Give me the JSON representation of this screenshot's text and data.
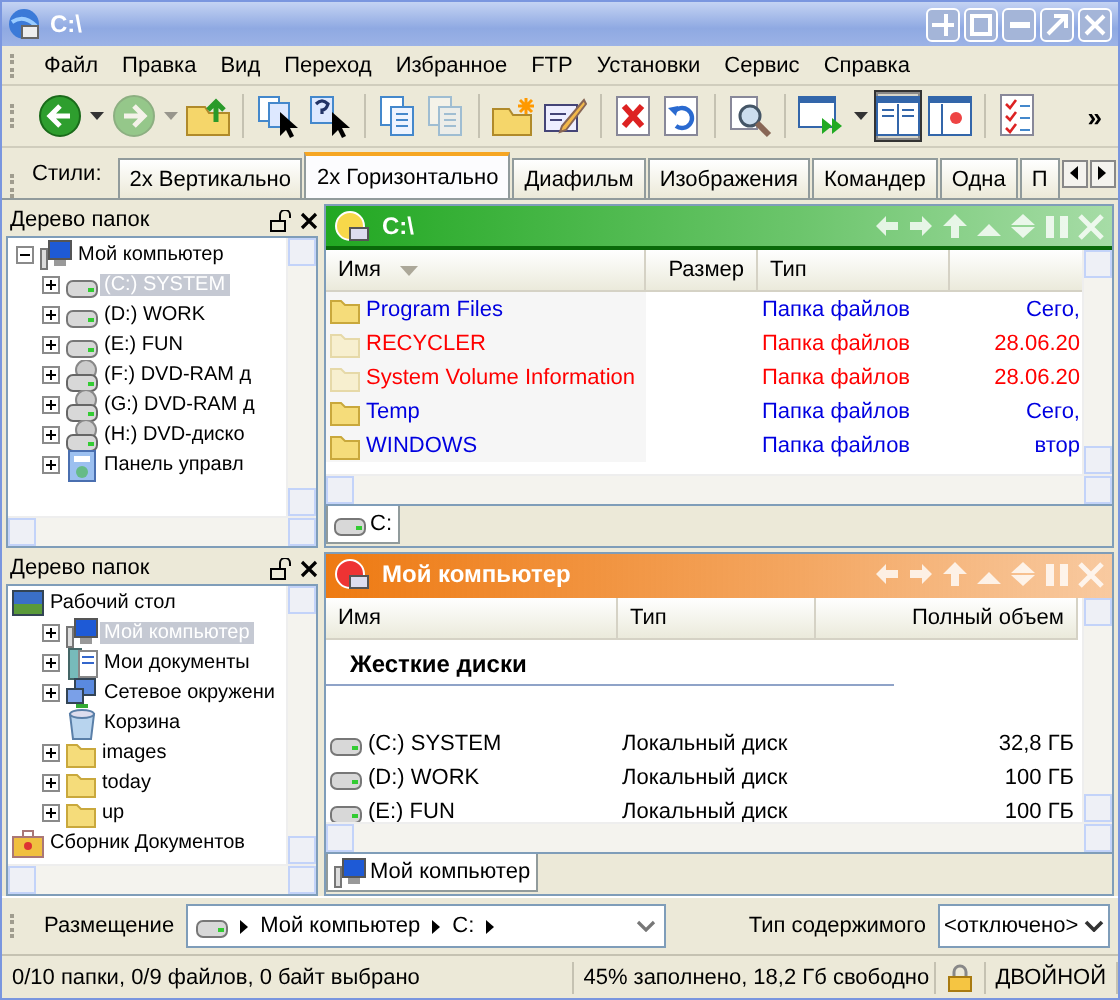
{
  "window": {
    "title": "C:\\"
  },
  "menu": [
    "Файл",
    "Правка",
    "Вид",
    "Переход",
    "Избранное",
    "FTP",
    "Установки",
    "Сервис",
    "Справка"
  ],
  "toolbar": {
    "groups": [
      [
        {
          "kind": "back",
          "disabled": false,
          "pressed": false
        },
        {
          "kind": "dropdown",
          "disabled": false,
          "pressed": false
        },
        {
          "kind": "forward",
          "disabled": true,
          "pressed": false
        },
        {
          "kind": "dropdown",
          "disabled": true,
          "pressed": false
        },
        {
          "kind": "parent",
          "disabled": false,
          "pressed": false
        }
      ],
      [
        {
          "kind": "select",
          "disabled": false,
          "pressed": false
        },
        {
          "kind": "help",
          "disabled": false,
          "pressed": false
        }
      ],
      [
        {
          "kind": "copy",
          "disabled": false,
          "pressed": false
        },
        {
          "kind": "paste",
          "disabled": true,
          "pressed": false
        }
      ],
      [
        {
          "kind": "newfolder",
          "disabled": false,
          "pressed": false
        },
        {
          "kind": "rename",
          "disabled": false,
          "pressed": false
        }
      ],
      [
        {
          "kind": "delete",
          "disabled": false,
          "pressed": false
        },
        {
          "kind": "undo",
          "disabled": false,
          "pressed": false
        }
      ],
      [
        {
          "kind": "find",
          "disabled": false,
          "pressed": false
        }
      ],
      [
        {
          "kind": "sync",
          "disabled": false,
          "pressed": false
        },
        {
          "kind": "dropdown",
          "disabled": false,
          "pressed": false
        },
        {
          "kind": "dual",
          "disabled": false,
          "pressed": true
        },
        {
          "kind": "viewer",
          "disabled": false,
          "pressed": false
        }
      ],
      [
        {
          "kind": "checklist",
          "disabled": false,
          "pressed": false
        }
      ]
    ],
    "overflow": "»"
  },
  "styles_bar": {
    "label": "Стили:",
    "tabs": [
      {
        "label": "2x Вертикально",
        "selected": false
      },
      {
        "label": "2x Горизонтально",
        "selected": true
      },
      {
        "label": "Диафильм",
        "selected": false
      },
      {
        "label": "Изображения",
        "selected": false
      },
      {
        "label": "Командер",
        "selected": false
      },
      {
        "label": "Одна",
        "selected": false
      },
      {
        "label": "П",
        "selected": false
      }
    ]
  },
  "folder_trees": [
    {
      "title": "Дерево папок",
      "items": [
        {
          "label": "Мой компьютер",
          "kind": "computer",
          "expanded": true,
          "selected": false,
          "children": [
            {
              "label": "(C:) SYSTEM",
              "kind": "drive",
              "expanded": false,
              "selected": true
            },
            {
              "label": "(D:) WORK",
              "kind": "drive",
              "expanded": false,
              "selected": false
            },
            {
              "label": "(E:) FUN",
              "kind": "drive",
              "expanded": false,
              "selected": false
            },
            {
              "label": "(F:) DVD-RAM д",
              "kind": "dvd",
              "expanded": false,
              "selected": false
            },
            {
              "label": "(G:) DVD-RAM д",
              "kind": "dvd",
              "expanded": false,
              "selected": false
            },
            {
              "label": "(H:) DVD-диско",
              "kind": "dvd",
              "expanded": false,
              "selected": false
            },
            {
              "label": "Панель управл",
              "kind": "controlpanel",
              "expanded": false,
              "selected": false
            }
          ]
        }
      ]
    },
    {
      "title": "Дерево папок",
      "items": [
        {
          "label": "Рабочий стол",
          "kind": "desktop",
          "selected": false,
          "children": [
            {
              "label": "Мой компьютер",
              "kind": "computer",
              "expanded": false,
              "selected": true
            },
            {
              "label": "Мои документы",
              "kind": "documents",
              "expanded": false,
              "selected": false
            },
            {
              "label": "Сетевое окружени",
              "kind": "network",
              "expanded": false,
              "selected": false
            },
            {
              "label": "Корзина",
              "kind": "recycle",
              "selected": false
            },
            {
              "label": "images",
              "kind": "folder",
              "expanded": false,
              "selected": false
            },
            {
              "label": "today",
              "kind": "folder",
              "expanded": false,
              "selected": false
            },
            {
              "label": "up",
              "kind": "folder",
              "expanded": false,
              "selected": false
            }
          ]
        },
        {
          "label": "Сборник Документов",
          "kind": "briefcase",
          "selected": false
        }
      ]
    }
  ],
  "file_panels": [
    {
      "title": "C:\\",
      "color": "#22a822",
      "active": true,
      "columns": [
        {
          "label": "Имя",
          "sorted": true
        },
        {
          "label": "Размер",
          "sorted": false
        },
        {
          "label": "Тип",
          "sorted": false
        },
        {
          "sorted": false
        }
      ],
      "sections": [
        {
          "rows": [
            {
              "kind": "folder",
              "hidden": false,
              "name": "Program Files",
              "type": "Папка файлов",
              "column_4": "Сего,"
            },
            {
              "kind": "folder",
              "hidden": true,
              "name": "RECYCLER",
              "type": "Папка файлов",
              "column_4": "28.06.20"
            },
            {
              "kind": "folder",
              "hidden": true,
              "name": "System Volume Information",
              "type": "Папка файлов",
              "column_4": "28.06.20"
            },
            {
              "kind": "folder",
              "hidden": false,
              "name": "Temp",
              "type": "Папка файлов",
              "column_4": "Сего,"
            },
            {
              "kind": "folder",
              "hidden": false,
              "name": "WINDOWS",
              "type": "Папка файлов",
              "column_4": "втор"
            }
          ]
        }
      ],
      "tabs": [
        {
          "label": "C:",
          "kind": "drive"
        }
      ]
    },
    {
      "title": "Мой компьютер",
      "color": "#ee7a12",
      "active": false,
      "columns": [
        {
          "label": "Имя",
          "sorted": false
        },
        {
          "label": "Тип",
          "sorted": false
        },
        {
          "label": "Полный объем",
          "sorted": false
        }
      ],
      "sections": [
        {
          "heading": "Жесткие диски",
          "rows": [
            {
              "kind": "drive",
              "name": "(C:) SYSTEM",
              "type": "Локальный диск",
              "total": "32,8 ГБ"
            },
            {
              "kind": "drive",
              "name": "(D:) WORK",
              "type": "Локальный диск",
              "total": "100 ГБ"
            },
            {
              "kind": "drive",
              "name": "(E:) FUN",
              "type": "Локальный диск",
              "total": "100 ГБ"
            }
          ]
        }
      ],
      "tabs": [
        {
          "label": "Мой компьютер",
          "kind": "computer"
        }
      ]
    }
  ],
  "address_bar": {
    "label": "Размещение",
    "path": [
      "Мой компьютер",
      "C:"
    ],
    "content_type_label": "Тип содержимого",
    "content_type_value": "<отключено>"
  },
  "status_bar": {
    "selection": "0/10 папки, 0/9 файлов, 0 байт выбрано",
    "disk": "45% заполнено, 18,2 Гб свободно",
    "mode": "ДВОЙНОЙ"
  }
}
